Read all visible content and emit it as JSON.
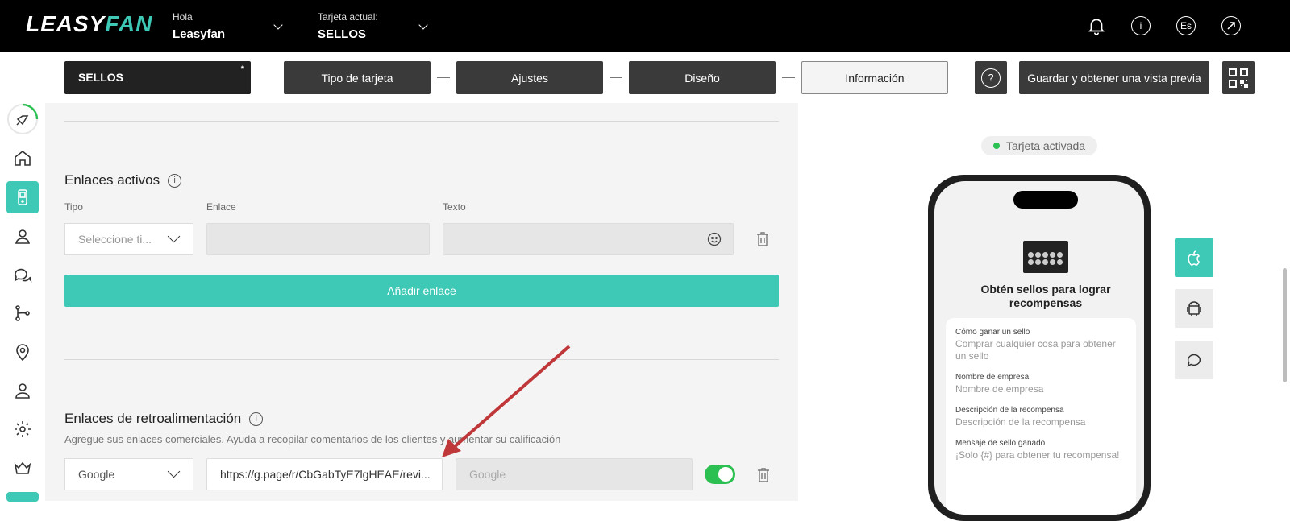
{
  "header": {
    "logo_a": "LEASY",
    "logo_b": "FAN",
    "greeting_small": "Hola",
    "greeting_name": "Leasyfan",
    "card_label": "Tarjeta actual:",
    "card_value": "SELLOS",
    "language": "Es"
  },
  "steps": {
    "card_name": "SELLOS",
    "star": "*",
    "tabs": [
      "Tipo de tarjeta",
      "Ajustes",
      "Diseño",
      "Información"
    ],
    "save_label": "Guardar y obtener una vista previa"
  },
  "active_links": {
    "title": "Enlaces activos",
    "label_type": "Tipo",
    "label_link": "Enlace",
    "label_text": "Texto",
    "type_placeholder": "Seleccione ti...",
    "add_label": "Añadir enlace"
  },
  "feedback_links": {
    "title": "Enlaces de retroalimentación",
    "description": "Agregue sus enlaces comerciales. Ayuda a recopilar comentarios de los clientes y aumentar su calificación",
    "type_value": "Google",
    "link_value": "https://g.page/r/CbGabTyE7lgHEAE/revi...",
    "text_placeholder": "Google",
    "enabled": true
  },
  "preview": {
    "status": "Tarjeta activada",
    "title": "Obtén sellos para lograr recompensas",
    "fields": [
      {
        "key": "Cómo ganar un sello",
        "value": "Comprar cualquier cosa para obtener un sello"
      },
      {
        "key": "Nombre de empresa",
        "value": "Nombre de empresa"
      },
      {
        "key": "Descripción de la recompensa",
        "value": "Descripción de la recompensa"
      },
      {
        "key": "Mensaje de sello ganado",
        "value": "¡Solo {#} para obtener tu recompensa!"
      }
    ]
  },
  "colors": {
    "accent": "#3ec8b6",
    "dark_button": "#3a3a3a",
    "toggle_on": "#2cc052",
    "annotation_arrow": "#c0373a"
  }
}
